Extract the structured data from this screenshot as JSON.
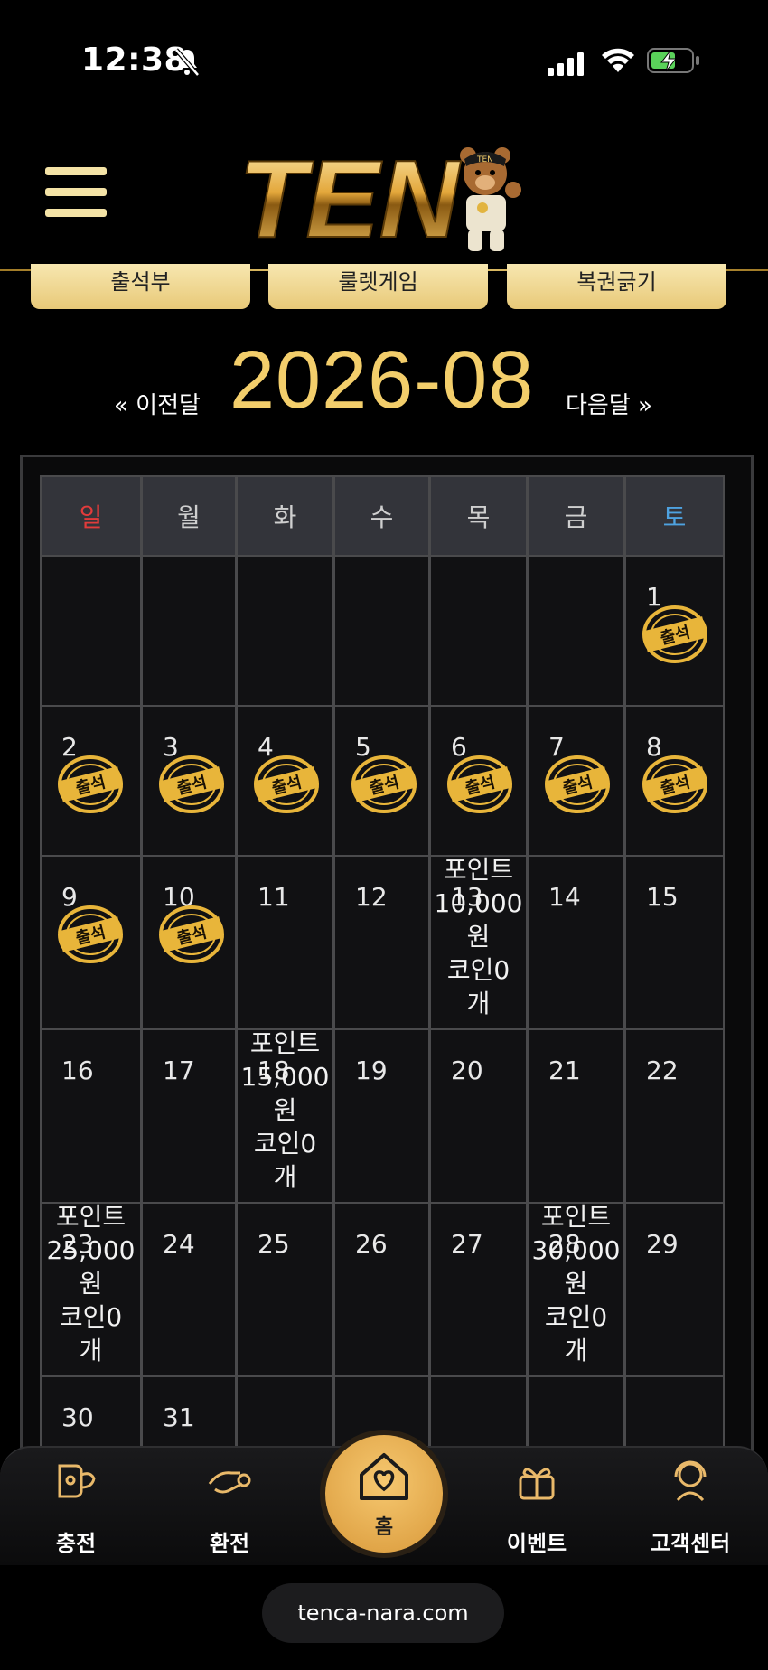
{
  "status_bar": {
    "time": "12:38"
  },
  "header": {
    "logo_text": "TEN",
    "logo_mascot_text": "TEN"
  },
  "tabs": [
    {
      "label": "출석부"
    },
    {
      "label": "룰렛게임"
    },
    {
      "label": "복권긁기"
    }
  ],
  "calendar": {
    "month_title": "2026-08",
    "prev_label": "« 이전달",
    "next_label": "다음달 »",
    "weekdays": [
      "일",
      "월",
      "화",
      "수",
      "목",
      "금",
      "토"
    ],
    "stamp_text": "출석",
    "weeks": [
      [
        {
          "day": ""
        },
        {
          "day": ""
        },
        {
          "day": ""
        },
        {
          "day": ""
        },
        {
          "day": ""
        },
        {
          "day": ""
        },
        {
          "day": "1",
          "stamp": true
        }
      ],
      [
        {
          "day": "2",
          "stamp": true
        },
        {
          "day": "3",
          "stamp": true
        },
        {
          "day": "4",
          "stamp": true
        },
        {
          "day": "5",
          "stamp": true
        },
        {
          "day": "6",
          "stamp": true
        },
        {
          "day": "7",
          "stamp": true
        },
        {
          "day": "8",
          "stamp": true
        }
      ],
      [
        {
          "day": "9",
          "stamp": true
        },
        {
          "day": "10",
          "stamp": true
        },
        {
          "day": "11"
        },
        {
          "day": "12"
        },
        {
          "day": "13",
          "reward": [
            "포인트",
            "10,000",
            "원",
            "코인0",
            "개"
          ]
        },
        {
          "day": "14"
        },
        {
          "day": "15"
        }
      ],
      [
        {
          "day": "16"
        },
        {
          "day": "17"
        },
        {
          "day": "18",
          "reward": [
            "포인트",
            "15,000",
            "원",
            "코인0",
            "개"
          ]
        },
        {
          "day": "19"
        },
        {
          "day": "20"
        },
        {
          "day": "21"
        },
        {
          "day": "22"
        }
      ],
      [
        {
          "day": "23",
          "reward": [
            "포인트",
            "25,000",
            "원",
            "코인0",
            "개"
          ]
        },
        {
          "day": "24"
        },
        {
          "day": "25"
        },
        {
          "day": "26"
        },
        {
          "day": "27"
        },
        {
          "day": "28",
          "reward": [
            "포인트",
            "30,000",
            "원",
            "코인0",
            "개"
          ]
        },
        {
          "day": "29"
        }
      ],
      [
        {
          "day": "30"
        },
        {
          "day": "31"
        },
        {
          "day": ""
        },
        {
          "day": ""
        },
        {
          "day": ""
        },
        {
          "day": ""
        },
        {
          "day": ""
        }
      ]
    ]
  },
  "bottom_nav": [
    {
      "label": "충전",
      "icon": "deposit-icon"
    },
    {
      "label": "환전",
      "icon": "withdraw-icon"
    },
    {
      "label": "홈",
      "icon": "home-heart-icon"
    },
    {
      "label": "이벤트",
      "icon": "gift-icon"
    },
    {
      "label": "고객센터",
      "icon": "headset-icon"
    }
  ],
  "url": "tenca-nara.com",
  "colors": {
    "gold": "#f3ce6b",
    "sunday": "#e23b3b",
    "saturday": "#4ea2e0"
  }
}
